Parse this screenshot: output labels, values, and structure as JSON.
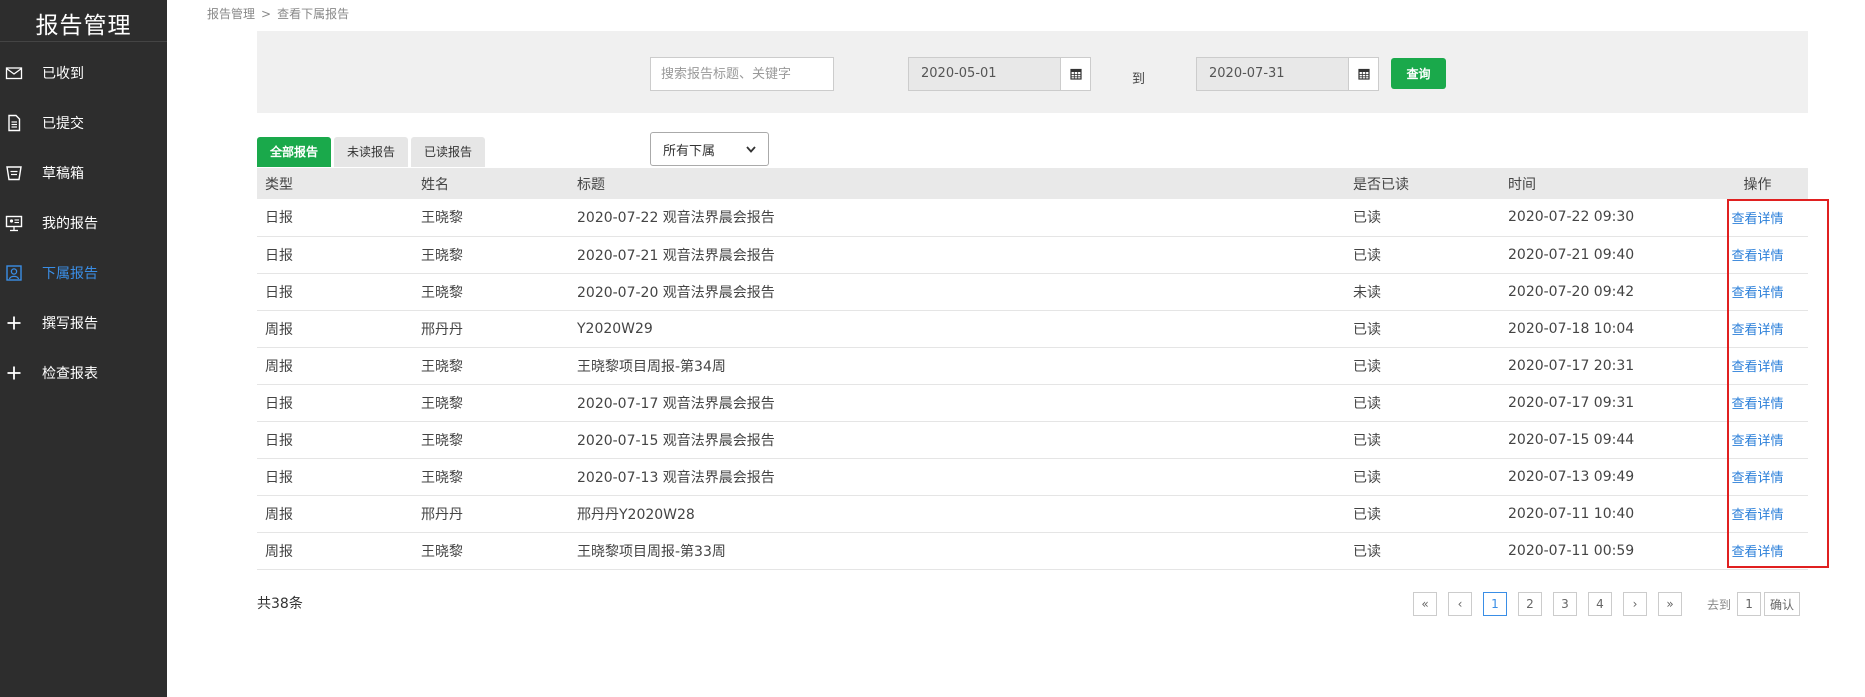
{
  "sidebar": {
    "title": "报告管理",
    "items": [
      {
        "label": "已收到",
        "icon": "mail-icon",
        "active": false
      },
      {
        "label": "已提交",
        "icon": "document-icon",
        "active": false
      },
      {
        "label": "草稿箱",
        "icon": "drafts-icon",
        "active": false
      },
      {
        "label": "我的报告",
        "icon": "presentation-icon",
        "active": false
      },
      {
        "label": "下属报告",
        "icon": "subordinate-icon",
        "active": true
      },
      {
        "label": "撰写报告",
        "icon": "plus-icon",
        "active": false
      },
      {
        "label": "检查报表",
        "icon": "plus-icon",
        "active": false
      }
    ]
  },
  "breadcrumb": {
    "root": "报告管理",
    "separator": ">",
    "current": "查看下属报告"
  },
  "filter": {
    "search_placeholder": "搜索报告标题、关键字",
    "date_start": "2020-05-01",
    "to_label": "到",
    "date_end": "2020-07-31",
    "query_label": "查询"
  },
  "tabs": [
    {
      "label": "全部报告",
      "active": true
    },
    {
      "label": "未读报告",
      "active": false
    },
    {
      "label": "已读报告",
      "active": false
    }
  ],
  "subordinate_select": {
    "value": "所有下属"
  },
  "table": {
    "headers": [
      "类型",
      "姓名",
      "标题",
      "是否已读",
      "时间",
      "操作"
    ],
    "action_label": "查看详情",
    "rows": [
      {
        "type": "日报",
        "name": "王晓黎",
        "title": "2020-07-22 观音法界晨会报告",
        "read": "已读",
        "time": "2020-07-22 09:30"
      },
      {
        "type": "日报",
        "name": "王晓黎",
        "title": "2020-07-21 观音法界晨会报告",
        "read": "已读",
        "time": "2020-07-21 09:40"
      },
      {
        "type": "日报",
        "name": "王晓黎",
        "title": "2020-07-20 观音法界晨会报告",
        "read": "未读",
        "time": "2020-07-20 09:42"
      },
      {
        "type": "周报",
        "name": "邢丹丹",
        "title": "Y2020W29",
        "read": "已读",
        "time": "2020-07-18 10:04"
      },
      {
        "type": "周报",
        "name": "王晓黎",
        "title": "王晓黎项目周报-第34周",
        "read": "已读",
        "time": "2020-07-17 20:31"
      },
      {
        "type": "日报",
        "name": "王晓黎",
        "title": "2020-07-17 观音法界晨会报告",
        "read": "已读",
        "time": "2020-07-17 09:31"
      },
      {
        "type": "日报",
        "name": "王晓黎",
        "title": "2020-07-15 观音法界晨会报告",
        "read": "已读",
        "time": "2020-07-15 09:44"
      },
      {
        "type": "日报",
        "name": "王晓黎",
        "title": "2020-07-13 观音法界晨会报告",
        "read": "已读",
        "time": "2020-07-13 09:49"
      },
      {
        "type": "周报",
        "name": "邢丹丹",
        "title": "邢丹丹Y2020W28",
        "read": "已读",
        "time": "2020-07-11 10:40"
      },
      {
        "type": "周报",
        "name": "王晓黎",
        "title": "王晓黎项目周报-第33周",
        "read": "已读",
        "time": "2020-07-11 00:59"
      }
    ]
  },
  "footer": {
    "total": "共38条",
    "pager": {
      "first": "«",
      "prev": "‹",
      "pages": [
        "1",
        "2",
        "3",
        "4"
      ],
      "current": "1",
      "next": "›",
      "last": "»",
      "goto_label": "去到",
      "goto_value": "1",
      "confirm_label": "确认"
    }
  },
  "colors": {
    "primary_green": "#1aa94b",
    "link_blue": "#2b7fd9",
    "sidebar_bg": "#2d2d2d",
    "highlight_red": "#e02020"
  }
}
